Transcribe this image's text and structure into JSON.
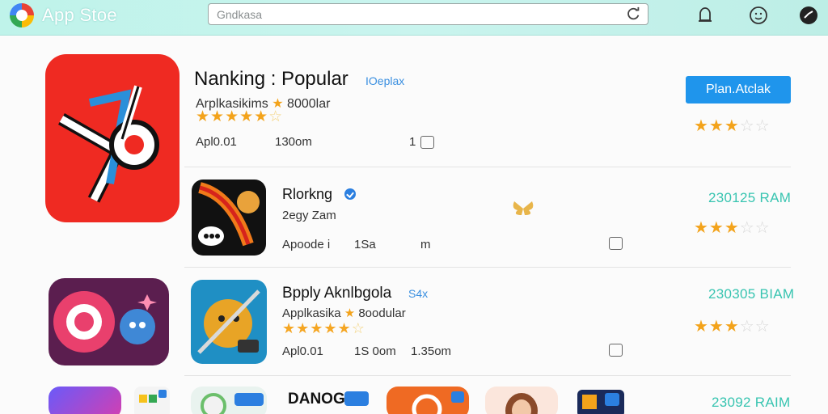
{
  "header": {
    "app_title": "App Stoe",
    "search_value": "Gndkasa",
    "icons": [
      "app-store-logo-icon",
      "refresh-icon",
      "bell-icon",
      "smiley-icon",
      "profile-icon"
    ]
  },
  "featured": {
    "title": "Nanking : Popular",
    "tag": "IOeplax",
    "subtitle_left": "Arplkasikims",
    "subtitle_right": "8000lar",
    "rating_stars": 5,
    "meta_a": "Apl0.01",
    "meta_b": "130om",
    "meta_c": "1",
    "install_label": "Plan.Atclak",
    "right_rating_stars": 3
  },
  "list": [
    {
      "title": "Rlorkng",
      "subtitle": "2egy Zam",
      "meta_a": "Apoode i",
      "meta_b": "1Sa",
      "meta_c": "m",
      "price": "230125 RAM",
      "rating_stars": 3,
      "verified": true
    },
    {
      "title": "Bpply Aknlbgola",
      "tag": "S4x",
      "subtitle_left": "Applkasika",
      "subtitle_right": "8oodular",
      "inline_rating_stars": 5,
      "meta_a": "Apl0.01",
      "meta_b": "1S 0om",
      "meta_c": "1.35om",
      "price": "230305 BIAM",
      "rating_stars": 3
    },
    {
      "title": "DANOG",
      "price": "23092 RAIM"
    }
  ],
  "colors": {
    "topbar": "#c3f2ec",
    "accent_blue": "#1f95ec",
    "price_teal": "#37c4b0",
    "star_gold": "#f3a31b",
    "featured_icon_red": "#ef2a22"
  }
}
